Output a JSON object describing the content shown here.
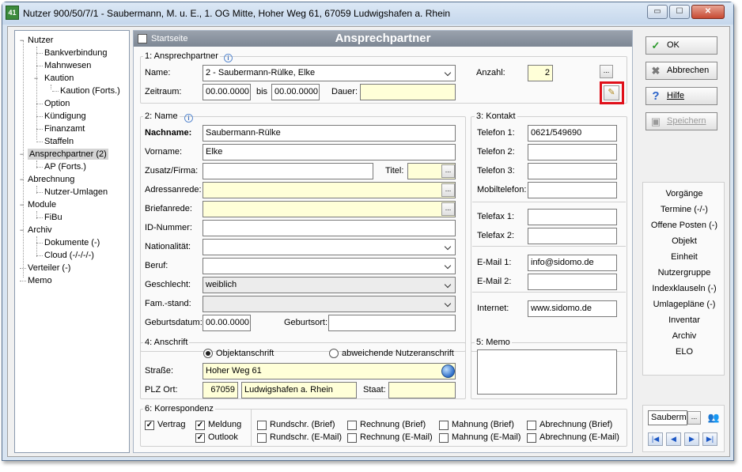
{
  "window": {
    "title": "Nutzer 900/50/7/1 - Saubermann, M. u. E., 1. OG Mitte, Hoher Weg 61, 67059 Ludwigshafen a. Rhein",
    "app_icon_text": "41",
    "minimize": "▭",
    "maximize": "☐",
    "close": "✕"
  },
  "tree": [
    {
      "label": "Nutzer",
      "expander": "−"
    },
    {
      "label": "Bankverbindung"
    },
    {
      "label": "Mahnwesen"
    },
    {
      "label": "Kaution",
      "expander": "−"
    },
    {
      "label": "Kaution (Forts.)"
    },
    {
      "label": "Option"
    },
    {
      "label": "Kündigung"
    },
    {
      "label": "Finanzamt"
    },
    {
      "label": "Staffeln"
    },
    {
      "label": "Ansprechpartner (2)",
      "expander": "−",
      "selected": true
    },
    {
      "label": "AP (Forts.)"
    },
    {
      "label": "Abrechnung",
      "expander": "−"
    },
    {
      "label": "Nutzer-Umlagen"
    },
    {
      "label": "Module",
      "expander": "−"
    },
    {
      "label": "FiBu"
    },
    {
      "label": "Archiv",
      "expander": "−"
    },
    {
      "label": "Dokumente (-)"
    },
    {
      "label": "Cloud (-/-/-/-)"
    },
    {
      "label": "Verteiler (-)"
    },
    {
      "label": "Memo"
    }
  ],
  "header": {
    "startseite": "Startseite",
    "title": "Ansprechpartner"
  },
  "group1": {
    "label": "1: Ansprechpartner",
    "name_label": "Name:",
    "name_value": "2 - Saubermann-Rülke, Elke",
    "zeitraum_label": "Zeitraum:",
    "zeitraum_from": "00.00.0000",
    "bis_label": "bis",
    "zeitraum_to": "00.00.0000",
    "dauer_label": "Dauer:",
    "dauer_value": "",
    "anzahl_label": "Anzahl:",
    "anzahl_value": "2",
    "dots": "..."
  },
  "group2": {
    "label": "2: Name",
    "nachname_label": "Nachname:",
    "nachname_value": "Saubermann-Rülke",
    "vorname_label": "Vorname:",
    "vorname_value": "Elke",
    "zusatz_label": "Zusatz/Firma:",
    "zusatz_value": "",
    "titel_label": "Titel:",
    "titel_value": "",
    "adressanrede_label": "Adressanrede:",
    "adressanrede_value": "",
    "briefanrede_label": "Briefanrede:",
    "briefanrede_value": "",
    "idnummer_label": "ID-Nummer:",
    "idnummer_value": "",
    "nationalitaet_label": "Nationalität:",
    "nationalitaet_value": "",
    "beruf_label": "Beruf:",
    "beruf_value": "",
    "geschlecht_label": "Geschlecht:",
    "geschlecht_value": "weiblich",
    "famstand_label": "Fam.-stand:",
    "famstand_value": "",
    "geburtsdatum_label": "Geburtsdatum:",
    "geburtsdatum_value": "00.00.0000",
    "geburtsort_label": "Geburtsort:",
    "geburtsort_value": ""
  },
  "group3": {
    "label": "3: Kontakt",
    "telefon1_label": "Telefon 1:",
    "telefon1_value": "0621/549690",
    "telefon2_label": "Telefon 2:",
    "telefon2_value": "",
    "telefon3_label": "Telefon 3:",
    "telefon3_value": "",
    "mobil_label": "Mobiltelefon:",
    "mobil_value": "",
    "fax1_label": "Telefax 1:",
    "fax1_value": "",
    "fax2_label": "Telefax 2:",
    "fax2_value": "",
    "email1_label": "E-Mail 1:",
    "email1_value": "info@sidomo.de",
    "email2_label": "E-Mail 2:",
    "email2_value": "",
    "internet_label": "Internet:",
    "internet_value": "www.sidomo.de"
  },
  "group4": {
    "label": "4: Anschrift",
    "radio1": "Objektanschrift",
    "radio2": "abweichende Nutzeranschrift",
    "selected": "Objektanschrift",
    "strasse_label": "Straße:",
    "strasse_value": "Hoher Weg 61",
    "plzort_label": "PLZ Ort:",
    "plz_value": "67059",
    "ort_value": "Ludwigshafen a. Rhein",
    "staat_label": "Staat:",
    "staat_value": ""
  },
  "group5": {
    "label": "5: Memo",
    "value": ""
  },
  "group6": {
    "label": "6: Korrespondenz",
    "vertrag": "Vertrag",
    "meldung": "Meldung",
    "outlook": "Outlook",
    "rundschr_brief": "Rundschr. (Brief)",
    "rechnung_brief": "Rechnung (Brief)",
    "mahnung_brief": "Mahnung (Brief)",
    "abrechnung_brief": "Abrechnung (Brief)",
    "rundschr_email": "Rundschr. (E-Mail)",
    "rechnung_email": "Rechnung (E-Mail)",
    "mahnung_email": "Mahnung (E-Mail)",
    "abrechnung_email": "Abrechnung (E-Mail)",
    "check_mark": "✓"
  },
  "buttons": {
    "ok": "OK",
    "abbrechen": "Abbrechen",
    "hilfe": "Hilfe",
    "speichern": "Speichern"
  },
  "nav_links": [
    "Vorgänge",
    "Termine (-/-)",
    "Offene Posten (-)",
    "Objekt",
    "Einheit",
    "Nutzergruppe",
    "Indexklauseln (-)",
    "Umlagepläne (-)",
    "Inventar",
    "Archiv",
    "ELO"
  ],
  "bottom": {
    "search_value": "Sauberm",
    "dots": "..."
  },
  "icons": {
    "ok": "check-icon",
    "abbrechen": "cancel-icon",
    "hilfe": "help-icon",
    "speichern": "save-icon",
    "edit": "notepad-icon",
    "globe": "globe-icon",
    "people": "people-icon"
  },
  "colors": {
    "highlight_box": "#e0101a",
    "yellow_field": "#ffffd8"
  }
}
